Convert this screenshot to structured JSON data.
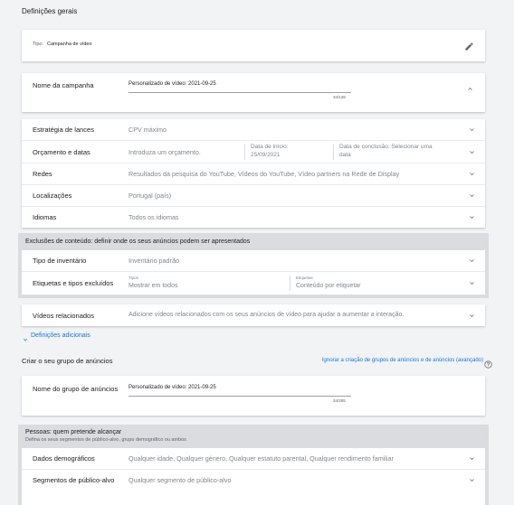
{
  "general": {
    "title": "Definições gerais",
    "type_prefix": "Tipo:",
    "type_value": "Campanha de vídeo"
  },
  "campaign_name": {
    "label": "Nome da campanha",
    "value": "Personalizado de vídeo: 2021-09-25",
    "counter": "34/128"
  },
  "settings": {
    "bidding": {
      "label": "Estratégia de lances",
      "value": "CPV máximo"
    },
    "budget": {
      "label": "Orçamento e datas",
      "value": "Introduza um orçamento.",
      "start_label": "Data de início:",
      "start_value": "25/09/2021",
      "end_label": "Data de conclusão: Selecionar uma",
      "end_value": "data"
    },
    "networks": {
      "label": "Redes",
      "value": "Resultados da pesquisa do YouTube, Vídeos do YouTube, Vídeo partners na Rede de Display"
    },
    "locations": {
      "label": "Localizações",
      "value": "Portugal (país)"
    },
    "languages": {
      "label": "Idiomas",
      "value": "Todos os idiomas"
    }
  },
  "exclusions": {
    "header": "Exclusões de conteúdo: definir onde os seus anúncios podem ser apresentados",
    "inventory": {
      "label": "Tipo de inventário",
      "value": "Inventário padrão"
    },
    "labels": {
      "label": "Etiquetas e tipos excluídos",
      "types_caption": "Tipos",
      "types_value": "Mostrar em todos",
      "tags_caption": "Etiquetas",
      "tags_value": "Conteúdo por etiquetar"
    }
  },
  "related_videos": {
    "label": "Vídeos relacionados",
    "value": "Adicione vídeos relacionados com os seus anúncios de vídeo para ajudar a aumentar a interação."
  },
  "additional_settings": "Definições adicionais",
  "ad_group": {
    "title": "Criar o seu grupo de anúncios",
    "skip_link": "Ignorar a criação de grupos de anúncios e de anúncios (avançado)",
    "name_label": "Nome do grupo de anúncios",
    "name_value": "Personalizado de vídeo: 2021-09-25",
    "counter": "34/255"
  },
  "people": {
    "header": "Pessoas: quem pretende alcançar",
    "subheader": "Defina os seus segmentos de público-alvo, grupo demográfico ou ambos",
    "demographics": {
      "label": "Dados demográficos",
      "value": "Qualquer idade, Qualquer género, Qualquer estatuto parental, Qualquer rendimento familiar"
    },
    "audiences": {
      "label": "Segmentos de público-alvo",
      "value": "Qualquer segmento de público-alvo"
    }
  },
  "colors": {
    "accent": "#1a73e8",
    "band": "#dadce0"
  }
}
